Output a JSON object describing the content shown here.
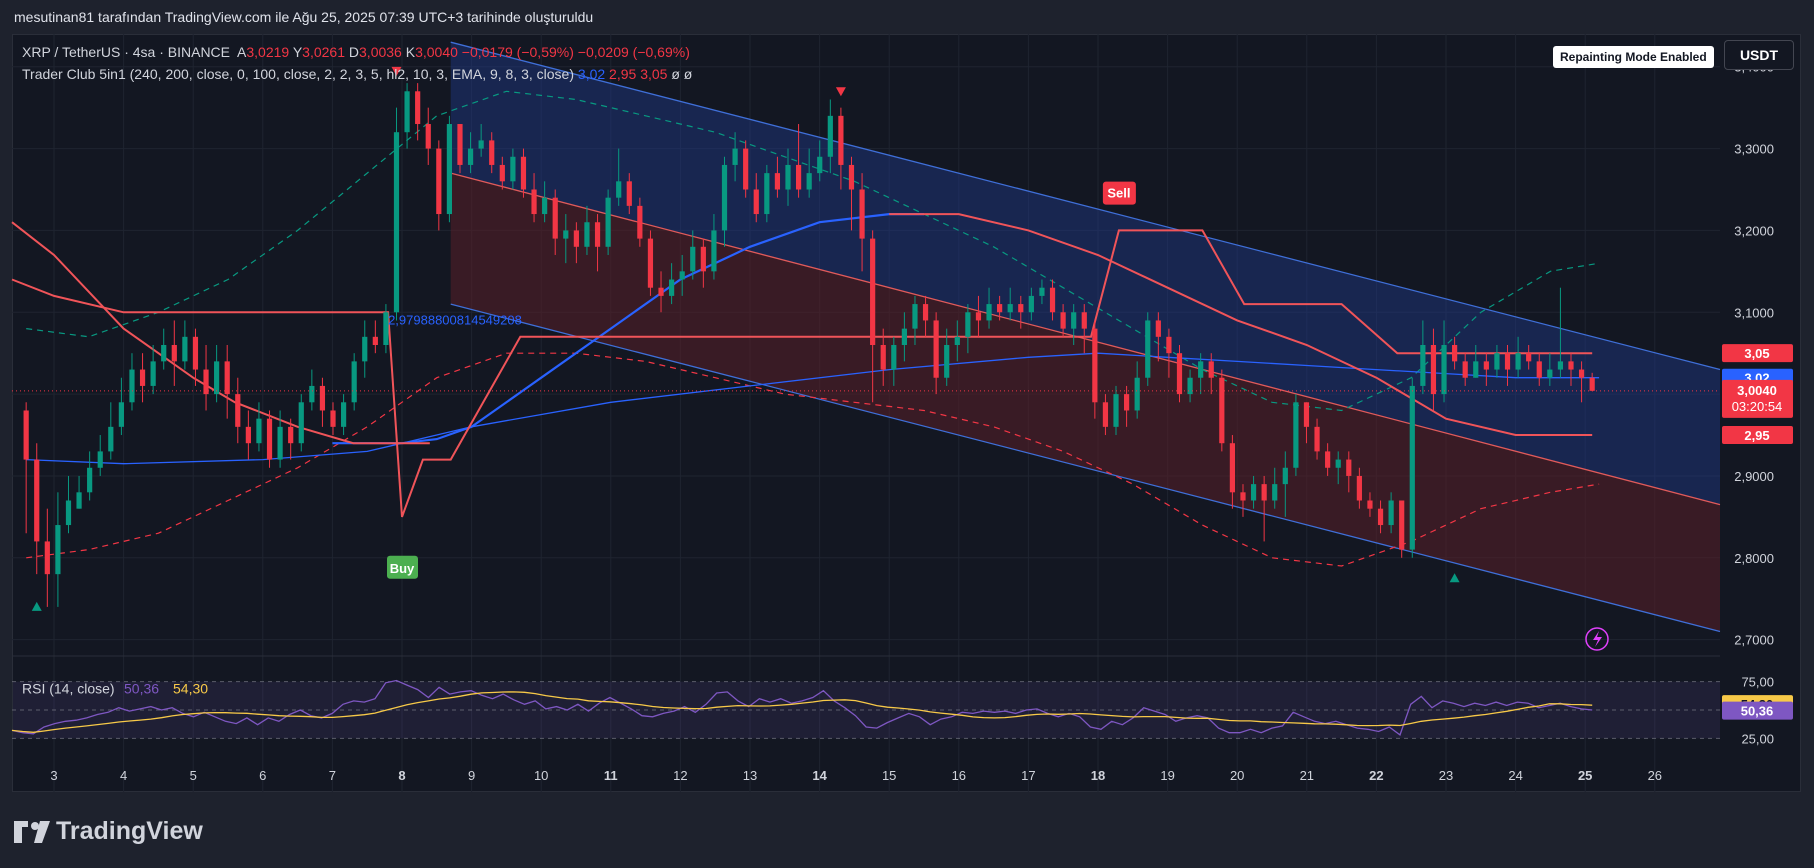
{
  "header": {
    "author_line": "mesutinan81 tarafından TradingView.com ile Ağu 25, 2025 07:39 UTC+3 tarihinde oluşturuldu"
  },
  "legend": {
    "symbol": "XRP / TetherUS · 4sa · BINANCE",
    "open_label": "A",
    "open": "3,0219",
    "high_label": "Y",
    "high": "3,0261",
    "low_label": "D",
    "low": "3,0036",
    "close_label": "K",
    "close": "3,0040",
    "change": "−0,0179 (−0,59%)",
    "change2": "−0,0209 (−0,69%)",
    "indicator": "Trader Club 5in1 (240, 200, close, 0, 100, close, 2, 2, 3, 5, hl2, 10, 3, EMA, 9, 8, 3, close)",
    "ind_v1": "3,02",
    "ind_v2": "2,95",
    "ind_v3": "3,05",
    "ind_v4": "ø",
    "ind_v5": "ø"
  },
  "badges": {
    "repaint": "Repainting Mode Enabled",
    "currency": "USDT"
  },
  "chart_labels": {
    "buy": "Buy",
    "sell": "Sell",
    "line_value": "2,9798880081454920‌8"
  },
  "price_axis": {
    "ticks": [
      "3,4000",
      "3,3000",
      "3,2000",
      "3,1000",
      "3,0000",
      "2,9000",
      "2,8000",
      "2,7000"
    ],
    "last_price": "3,0040",
    "countdown": "03:20:54",
    "tag_upper": "3,05",
    "tag_mid": "3,02",
    "tag_lower": "2,95"
  },
  "time_axis": {
    "ticks": [
      "3",
      "4",
      "5",
      "6",
      "7",
      "8",
      "9",
      "10",
      "11",
      "12",
      "13",
      "14",
      "15",
      "16",
      "17",
      "18",
      "19",
      "20",
      "21",
      "22",
      "23",
      "24",
      "25",
      "26"
    ],
    "bold": [
      "8",
      "11",
      "14",
      "18",
      "22",
      "25"
    ]
  },
  "rsi": {
    "title": "RSI (14, close)",
    "rsi_value": "50,36",
    "ma_value": "54,30",
    "ticks": [
      "75,00",
      "25,00"
    ]
  },
  "brand": {
    "name": "TradingView"
  },
  "colors": {
    "up": "#089981",
    "down": "#f23645",
    "ema": "#2962ff",
    "channel_upper_fill": "#1e3a8a",
    "channel_lower_fill": "#5a1f28",
    "rsi_line": "#7e57c2",
    "rsi_ma": "#f7c948"
  },
  "chart_data": {
    "type": "candlestick",
    "ylim": [
      2.68,
      3.44
    ],
    "candles": [
      [
        2.98,
        2.92,
        2.99,
        2.83
      ],
      [
        2.92,
        2.82,
        2.94,
        2.78
      ],
      [
        2.82,
        2.78,
        2.86,
        2.74
      ],
      [
        2.78,
        2.84,
        2.88,
        2.74
      ],
      [
        2.84,
        2.87,
        2.9,
        2.83
      ],
      [
        2.86,
        2.88,
        2.9,
        2.86
      ],
      [
        2.88,
        2.91,
        2.93,
        2.87
      ],
      [
        2.91,
        2.93,
        2.95,
        2.9
      ],
      [
        2.93,
        2.96,
        2.99,
        2.92
      ],
      [
        2.96,
        2.99,
        3.02,
        2.95
      ],
      [
        2.99,
        3.03,
        3.05,
        2.98
      ],
      [
        3.03,
        3.01,
        3.05,
        2.99
      ],
      [
        3.01,
        3.04,
        3.06,
        3.0
      ],
      [
        3.04,
        3.06,
        3.08,
        3.03
      ],
      [
        3.06,
        3.04,
        3.09,
        3.01
      ],
      [
        3.04,
        3.07,
        3.09,
        3.03
      ],
      [
        3.07,
        3.03,
        3.08,
        3.01
      ],
      [
        3.03,
        3.0,
        3.06,
        2.98
      ],
      [
        3.0,
        3.04,
        3.06,
        2.99
      ],
      [
        3.04,
        3.0,
        3.06,
        2.97
      ],
      [
        3.0,
        2.96,
        3.02,
        2.94
      ],
      [
        2.96,
        2.94,
        2.98,
        2.92
      ],
      [
        2.94,
        2.97,
        2.99,
        2.93
      ],
      [
        2.97,
        2.92,
        2.98,
        2.91
      ],
      [
        2.92,
        2.96,
        2.98,
        2.91
      ],
      [
        2.96,
        2.94,
        2.97,
        2.92
      ],
      [
        2.94,
        2.99,
        3.0,
        2.93
      ],
      [
        2.99,
        3.01,
        3.03,
        2.98
      ],
      [
        3.01,
        2.98,
        3.02,
        2.96
      ],
      [
        2.98,
        2.96,
        2.99,
        2.95
      ],
      [
        2.96,
        2.99,
        3.0,
        2.95
      ],
      [
        2.99,
        3.04,
        3.05,
        2.98
      ],
      [
        3.04,
        3.07,
        3.09,
        3.02
      ],
      [
        3.07,
        3.06,
        3.09,
        3.05
      ],
      [
        3.06,
        3.1,
        3.11,
        3.05
      ],
      [
        3.1,
        3.32,
        3.35,
        3.09
      ],
      [
        3.32,
        3.37,
        3.38,
        3.3
      ],
      [
        3.37,
        3.33,
        3.38,
        3.31
      ],
      [
        3.33,
        3.3,
        3.35,
        3.28
      ],
      [
        3.3,
        3.22,
        3.31,
        3.2
      ],
      [
        3.22,
        3.33,
        3.34,
        3.21
      ],
      [
        3.33,
        3.28,
        3.33,
        3.27
      ],
      [
        3.28,
        3.3,
        3.32,
        3.27
      ],
      [
        3.3,
        3.31,
        3.33,
        3.29
      ],
      [
        3.31,
        3.28,
        3.32,
        3.27
      ],
      [
        3.28,
        3.26,
        3.29,
        3.25
      ],
      [
        3.26,
        3.29,
        3.3,
        3.25
      ],
      [
        3.29,
        3.25,
        3.3,
        3.24
      ],
      [
        3.25,
        3.22,
        3.27,
        3.21
      ],
      [
        3.22,
        3.24,
        3.26,
        3.21
      ],
      [
        3.24,
        3.19,
        3.25,
        3.17
      ],
      [
        3.19,
        3.2,
        3.22,
        3.16
      ],
      [
        3.2,
        3.18,
        3.21,
        3.16
      ],
      [
        3.18,
        3.21,
        3.23,
        3.17
      ],
      [
        3.21,
        3.18,
        3.22,
        3.15
      ],
      [
        3.18,
        3.24,
        3.25,
        3.17
      ],
      [
        3.24,
        3.26,
        3.3,
        3.23
      ],
      [
        3.26,
        3.23,
        3.27,
        3.22
      ],
      [
        3.23,
        3.19,
        3.24,
        3.18
      ],
      [
        3.19,
        3.13,
        3.2,
        3.12
      ],
      [
        3.13,
        3.12,
        3.15,
        3.1
      ],
      [
        3.12,
        3.14,
        3.16,
        3.11
      ],
      [
        3.14,
        3.15,
        3.17,
        3.12
      ],
      [
        3.15,
        3.18,
        3.2,
        3.14
      ],
      [
        3.18,
        3.15,
        3.19,
        3.13
      ],
      [
        3.15,
        3.2,
        3.22,
        3.14
      ],
      [
        3.2,
        3.28,
        3.29,
        3.18
      ],
      [
        3.28,
        3.3,
        3.32,
        3.26
      ],
      [
        3.3,
        3.25,
        3.31,
        3.24
      ],
      [
        3.25,
        3.22,
        3.27,
        3.21
      ],
      [
        3.22,
        3.27,
        3.28,
        3.21
      ],
      [
        3.27,
        3.25,
        3.29,
        3.24
      ],
      [
        3.25,
        3.28,
        3.3,
        3.23
      ],
      [
        3.28,
        3.25,
        3.33,
        3.24
      ],
      [
        3.25,
        3.27,
        3.3,
        3.24
      ],
      [
        3.27,
        3.29,
        3.31,
        3.26
      ],
      [
        3.29,
        3.34,
        3.36,
        3.27
      ],
      [
        3.34,
        3.28,
        3.35,
        3.25
      ],
      [
        3.28,
        3.25,
        3.29,
        3.2
      ],
      [
        3.25,
        3.19,
        3.27,
        3.15
      ],
      [
        3.19,
        3.06,
        3.2,
        2.99
      ],
      [
        3.06,
        3.03,
        3.08,
        3.01
      ],
      [
        3.03,
        3.06,
        3.07,
        3.01
      ],
      [
        3.06,
        3.08,
        3.1,
        3.04
      ],
      [
        3.08,
        3.11,
        3.12,
        3.06
      ],
      [
        3.11,
        3.09,
        3.12,
        3.07
      ],
      [
        3.09,
        3.02,
        3.1,
        3.0
      ],
      [
        3.02,
        3.06,
        3.08,
        3.01
      ],
      [
        3.06,
        3.07,
        3.09,
        3.04
      ],
      [
        3.07,
        3.1,
        3.11,
        3.05
      ],
      [
        3.1,
        3.09,
        3.12,
        3.07
      ],
      [
        3.09,
        3.11,
        3.13,
        3.08
      ],
      [
        3.11,
        3.1,
        3.12,
        3.09
      ],
      [
        3.1,
        3.11,
        3.13,
        3.09
      ],
      [
        3.11,
        3.1,
        3.12,
        3.08
      ],
      [
        3.1,
        3.12,
        3.13,
        3.09
      ],
      [
        3.12,
        3.13,
        3.14,
        3.11
      ],
      [
        3.13,
        3.1,
        3.14,
        3.09
      ],
      [
        3.1,
        3.08,
        3.11,
        3.07
      ],
      [
        3.08,
        3.1,
        3.11,
        3.06
      ],
      [
        3.1,
        3.08,
        3.11,
        3.05
      ],
      [
        3.08,
        2.99,
        3.09,
        2.97
      ],
      [
        2.99,
        2.96,
        3.0,
        2.95
      ],
      [
        2.96,
        3.0,
        3.01,
        2.95
      ],
      [
        3.0,
        2.98,
        3.01,
        2.96
      ],
      [
        2.98,
        3.02,
        3.04,
        2.97
      ],
      [
        3.02,
        3.09,
        3.1,
        3.01
      ],
      [
        3.09,
        3.07,
        3.1,
        3.04
      ],
      [
        3.07,
        3.05,
        3.08,
        3.02
      ],
      [
        3.05,
        3.0,
        3.06,
        2.99
      ],
      [
        3.0,
        3.02,
        3.03,
        2.99
      ],
      [
        3.02,
        3.04,
        3.05,
        3.0
      ],
      [
        3.04,
        3.02,
        3.05,
        3.0
      ],
      [
        3.02,
        2.94,
        3.03,
        2.93
      ],
      [
        2.94,
        2.88,
        2.95,
        2.86
      ],
      [
        2.88,
        2.87,
        2.89,
        2.85
      ],
      [
        2.87,
        2.89,
        2.9,
        2.86
      ],
      [
        2.89,
        2.87,
        2.9,
        2.82
      ],
      [
        2.87,
        2.89,
        2.91,
        2.86
      ],
      [
        2.89,
        2.91,
        2.93,
        2.85
      ],
      [
        2.91,
        2.99,
        3.0,
        2.9
      ],
      [
        2.99,
        2.96,
        2.99,
        2.94
      ],
      [
        2.96,
        2.93,
        2.97,
        2.92
      ],
      [
        2.93,
        2.91,
        2.94,
        2.9
      ],
      [
        2.91,
        2.92,
        2.93,
        2.89
      ],
      [
        2.92,
        2.9,
        2.93,
        2.88
      ],
      [
        2.9,
        2.87,
        2.91,
        2.86
      ],
      [
        2.87,
        2.86,
        2.88,
        2.85
      ],
      [
        2.86,
        2.84,
        2.87,
        2.83
      ],
      [
        2.84,
        2.87,
        2.88,
        2.83
      ],
      [
        2.87,
        2.81,
        2.87,
        2.8
      ],
      [
        2.81,
        3.01,
        3.02,
        2.8
      ],
      [
        3.01,
        3.06,
        3.09,
        3.0
      ],
      [
        3.06,
        3.0,
        3.08,
        2.98
      ],
      [
        3.0,
        3.06,
        3.09,
        2.99
      ],
      [
        3.06,
        3.04,
        3.07,
        3.03
      ],
      [
        3.04,
        3.02,
        3.05,
        3.01
      ],
      [
        3.02,
        3.04,
        3.06,
        3.02
      ],
      [
        3.04,
        3.03,
        3.05,
        3.01
      ],
      [
        3.03,
        3.05,
        3.06,
        3.02
      ],
      [
        3.05,
        3.03,
        3.06,
        3.01
      ],
      [
        3.03,
        3.05,
        3.07,
        3.02
      ],
      [
        3.05,
        3.04,
        3.06,
        3.03
      ],
      [
        3.04,
        3.02,
        3.05,
        3.01
      ],
      [
        3.02,
        3.03,
        3.05,
        3.01
      ],
      [
        3.03,
        3.04,
        3.13,
        3.02
      ],
      [
        3.04,
        3.03,
        3.05,
        3.01
      ],
      [
        3.03,
        3.02,
        3.04,
        2.99
      ],
      [
        3.02,
        3.004,
        3.026,
        3.0036
      ]
    ],
    "rsi_values": [
      32,
      30,
      29,
      35,
      38,
      40,
      41,
      43,
      46,
      48,
      52,
      49,
      51,
      53,
      50,
      52,
      47,
      44,
      48,
      44,
      40,
      38,
      43,
      37,
      43,
      40,
      46,
      50,
      45,
      43,
      47,
      55,
      58,
      57,
      60,
      74,
      76,
      72,
      68,
      61,
      70,
      64,
      66,
      67,
      63,
      60,
      64,
      59,
      55,
      58,
      51,
      53,
      50,
      55,
      49,
      56,
      61,
      56,
      51,
      45,
      44,
      47,
      49,
      53,
      48,
      55,
      65,
      66,
      58,
      53,
      60,
      57,
      60,
      56,
      58,
      61,
      67,
      58,
      52,
      45,
      35,
      34,
      39,
      43,
      47,
      44,
      37,
      42,
      44,
      48,
      47,
      49,
      48,
      49,
      47,
      50,
      51,
      47,
      44,
      47,
      44,
      35,
      33,
      40,
      37,
      43,
      52,
      49,
      46,
      40,
      43,
      45,
      43,
      34,
      30,
      30,
      33,
      30,
      34,
      36,
      48,
      44,
      40,
      38,
      40,
      37,
      34,
      33,
      31,
      35,
      28,
      55,
      62,
      52,
      58,
      56,
      53,
      56,
      54,
      57,
      54,
      57,
      56,
      52,
      54,
      56,
      53,
      51,
      50
    ]
  }
}
